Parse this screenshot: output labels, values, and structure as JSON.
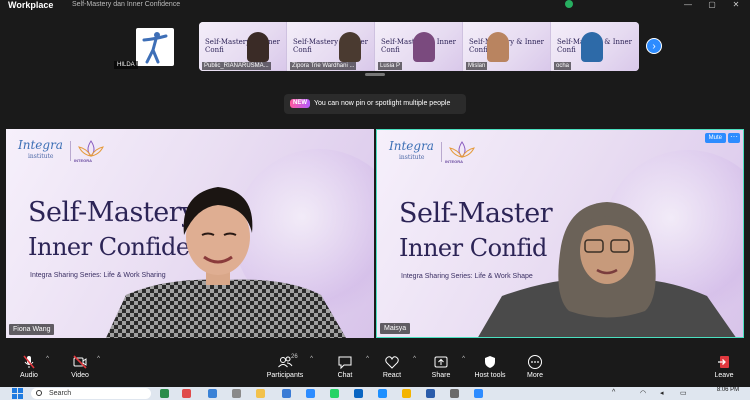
{
  "window": {
    "app_name": "Workplace",
    "meeting_title": "Self-Mastery dan Inner Confidence",
    "controls": [
      "—",
      "▢",
      "✕"
    ]
  },
  "self_view": {
    "name": "HILDA"
  },
  "gallery": {
    "participants": [
      {
        "name": "Public_RIANARUSMA...",
        "slide_title": "Self-Mastery & Inner Confi",
        "hair": "#3a2b26",
        "skin": "#d5a98e"
      },
      {
        "name": "Zipora Trie Wardhani ...",
        "slide_title": "Self-Mastery & Inner Confi",
        "hair": "#4a3a30",
        "skin": "#caa088"
      },
      {
        "name": "Lusia P",
        "slide_title": "Self-Mastery & Inner Confi",
        "hair": "#7a4a7e",
        "skin": "#c79a7f"
      },
      {
        "name": "Mislan",
        "slide_title": "Self-Mastery & Inner Confi",
        "hair": "#222",
        "skin": "#b98460"
      },
      {
        "name": "ocha",
        "slide_title": "Self-Mastery & Inner Confi",
        "hair": "#2d6aa8",
        "skin": "#d2a487"
      }
    ],
    "next_icon": "›"
  },
  "notice": {
    "badge": "NEW",
    "text": "You can now pin or spotlight multiple people"
  },
  "tiles": [
    {
      "name": "Fiona Wang",
      "logo": "Integra",
      "logo_sub": "institute",
      "lotus_label": "INTEGRA",
      "title_line1": "Self-Mastery",
      "title_line2": "Inner Confide",
      "subtitle": "Integra Sharing Series: Life & Work Sharing"
    },
    {
      "name": "Maisya",
      "logo": "Integra",
      "logo_sub": "institute",
      "lotus_label": "INTEGRA",
      "title_line1": "Self-Master",
      "title_line2": "Inner Confid",
      "subtitle": "Integra Sharing Series: Life & Work Shape",
      "mute_label": "Mute",
      "more_label": "···"
    }
  ],
  "toolbar": {
    "audio": "Audio",
    "video": "Video",
    "participants": "Participants",
    "participants_count": "26",
    "chat": "Chat",
    "react": "React",
    "share": "Share",
    "host_tools": "Host tools",
    "more": "More",
    "leave": "Leave"
  },
  "taskbar": {
    "search_placeholder": "Search",
    "time": "8:06 PM",
    "date": "11/15/2024",
    "tray_icons": [
      "chevron-up-icon",
      "wifi-icon",
      "speaker-icon",
      "battery-icon"
    ]
  },
  "colors": {
    "accent_blue": "#2d8cff",
    "active_speaker_border": "#4be0c0",
    "slide_text": "#2c2456",
    "leave_red": "#e0383e"
  }
}
